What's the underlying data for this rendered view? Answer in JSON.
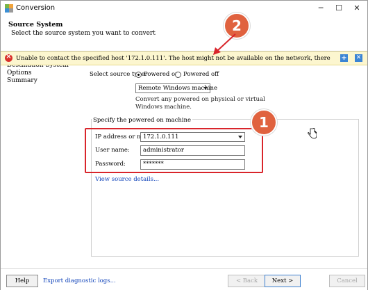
{
  "window": {
    "title": "Conversion",
    "icon": "vmware-converter-icon",
    "controls": {
      "minimize": "─",
      "maximize": "☐",
      "close": "✕"
    }
  },
  "header": {
    "title": "Source System",
    "subtitle": "Select the source system you want to convert"
  },
  "error_bar": {
    "message": "Unable to contact the specified host '172.1.0.111'. The host might not be available on the network, there might be a network configuration proble···",
    "icon": "error-icon",
    "expand_icon": "+",
    "close_icon": "✕",
    "colors": {
      "background": "#fcf6cf",
      "icon": "#d9312b",
      "buttons": "#3b84d4"
    }
  },
  "nav": {
    "items": [
      {
        "label": "Destination System"
      },
      {
        "label": "Options"
      },
      {
        "label": "Summary"
      }
    ]
  },
  "source": {
    "type_label": "Select source type:",
    "options": [
      {
        "label": "Powered on",
        "selected": true
      },
      {
        "label": "Powered off",
        "selected": false
      }
    ],
    "machine_type": "Remote Windows machine",
    "description_line1": "Convert any powered on physical or virtual",
    "description_line2": "Windows machine."
  },
  "machine_group": {
    "title": "Specify the powered on machine",
    "ip_label": "IP address or name:",
    "ip_value": "172.1.0.111",
    "user_label": "User name:",
    "user_value": "administrator",
    "password_label": "Password:",
    "password_value": "*******",
    "details_link": "View source details..."
  },
  "annotations": {
    "badge_1": "1",
    "badge_2": "2",
    "color": "#e0623f",
    "highlight_color": "#d9252b"
  },
  "footer": {
    "help": "Help",
    "export_link": "Export diagnostic logs...",
    "back": "< Back",
    "next": "Next >",
    "cancel": "Cancel"
  }
}
